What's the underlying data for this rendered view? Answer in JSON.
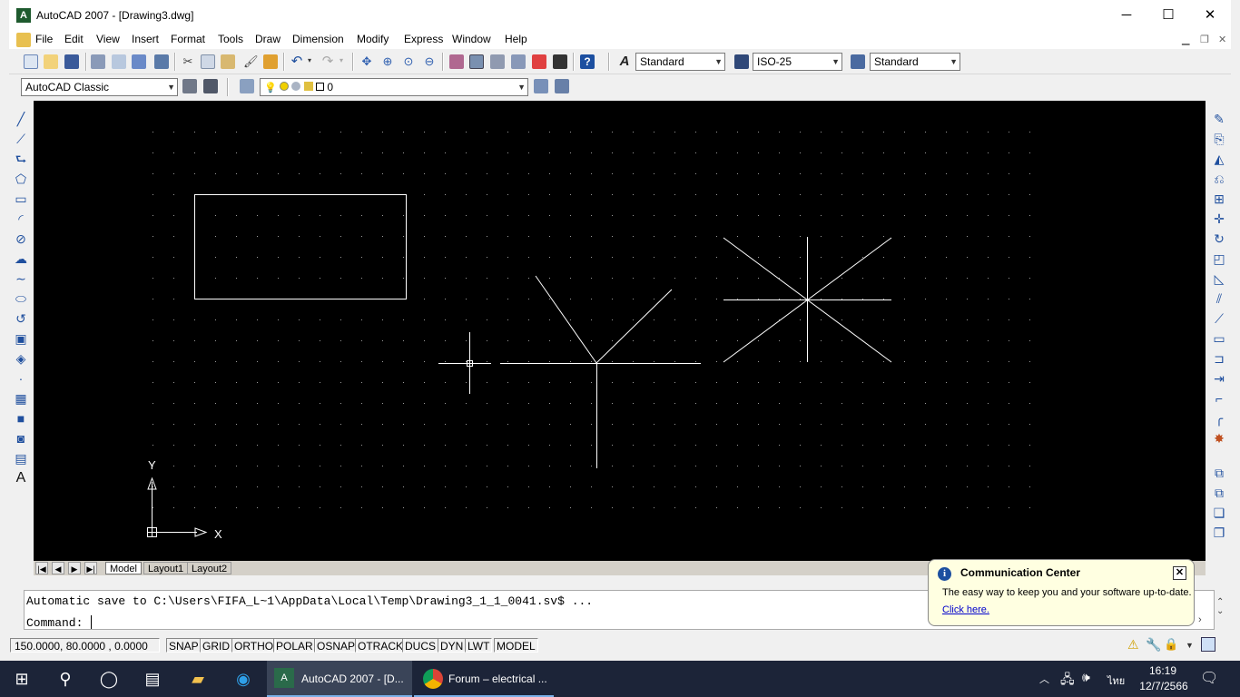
{
  "window": {
    "title": "AutoCAD 2007 - [Drawing3.dwg]",
    "app_icon": "A",
    "min": "─",
    "max": "☐",
    "close": "✕"
  },
  "menu": [
    "File",
    "Edit",
    "View",
    "Insert",
    "Format",
    "Tools",
    "Draw",
    "Dimension",
    "Modify",
    "Express",
    "Window",
    "Help"
  ],
  "toolbar": {
    "text_style": "Standard",
    "dim_style": "ISO-25",
    "table_style": "Standard",
    "workspace": "AutoCAD Classic",
    "layer": "0"
  },
  "tabs": {
    "model": "Model",
    "layout1": "Layout1",
    "layout2": "Layout2"
  },
  "ucs": {
    "x_label": "X",
    "y_label": "Y"
  },
  "command": {
    "history": "Automatic save to C:\\Users\\FIFA_L~1\\AppData\\Local\\Temp\\Drawing3_1_1_0041.sv$ ...",
    "prompt": "Command:"
  },
  "status": {
    "coords": "150.0000, 80.0000 , 0.0000",
    "toggles": [
      "SNAP",
      "GRID",
      "ORTHO",
      "POLAR",
      "OSNAP",
      "OTRACK",
      "DUCS",
      "DYN",
      "LWT",
      "MODEL"
    ]
  },
  "balloon": {
    "title": "Communication Center",
    "body": "The easy way to keep you and your software up-to-date.",
    "link": "Click here."
  },
  "taskbar": {
    "app1": "AutoCAD 2007 - [D...",
    "app2": "Forum – electrical ...",
    "lang": "ไทย",
    "time": "16:19",
    "date": "12/7/2566"
  },
  "colors": {
    "canvas": "#000000",
    "taskbar": "#1c2438",
    "balloon": "#ffffe1",
    "link": "#0000cc"
  }
}
